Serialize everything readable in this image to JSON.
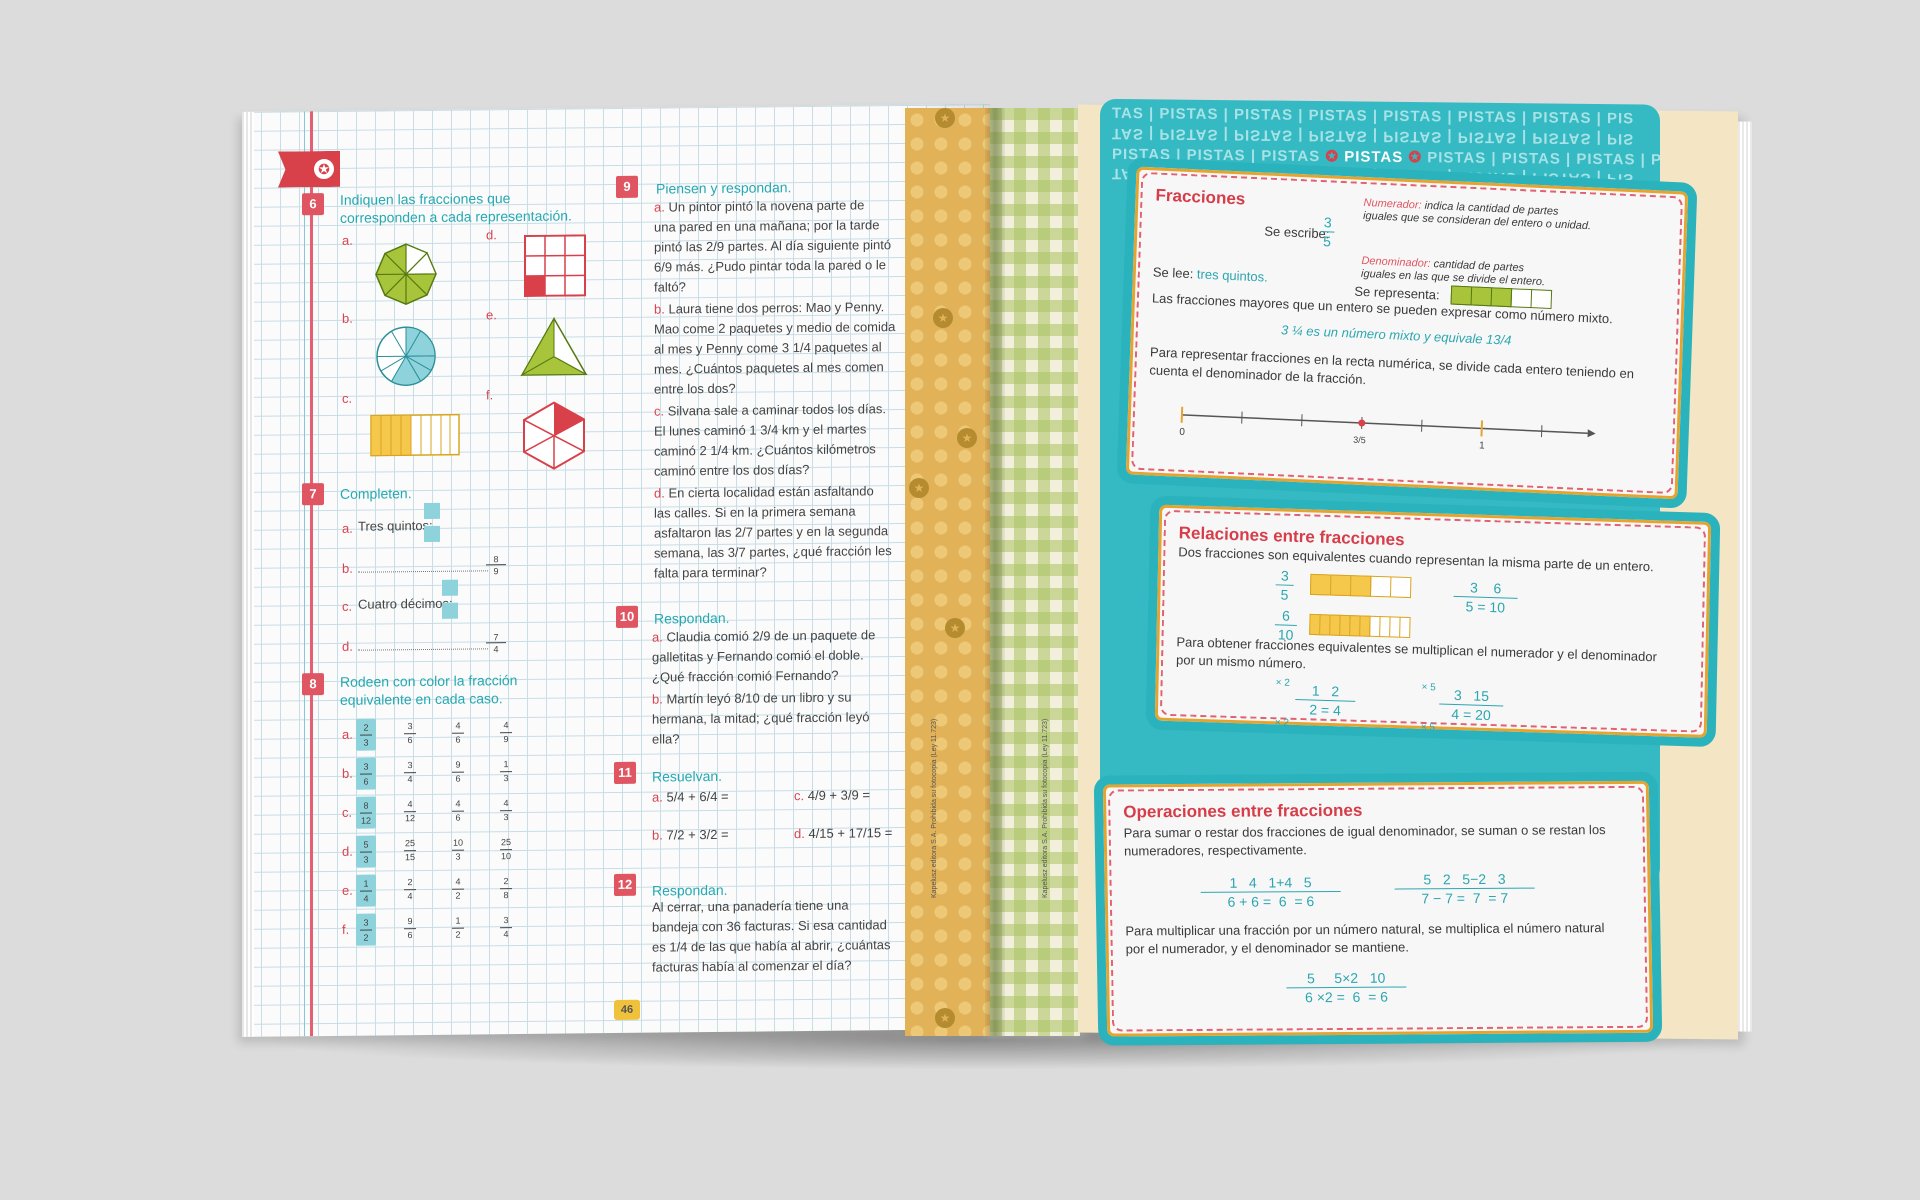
{
  "left_page": {
    "page_number": "46",
    "ex6": {
      "num": "6",
      "title_1": "Indiquen las fracciones que",
      "title_2": "corresponden a cada representación.",
      "labels": [
        "a.",
        "b.",
        "c.",
        "d.",
        "e.",
        "f."
      ]
    },
    "ex7": {
      "num": "7",
      "title": "Completen.",
      "items": [
        {
          "label": "a.",
          "text": "Tres quintos:"
        },
        {
          "label": "b.",
          "text": ": 8/9"
        },
        {
          "label": "c.",
          "text": "Cuatro décimos:"
        },
        {
          "label": "d.",
          "text": ": 7/4"
        }
      ],
      "frac_b": [
        "8",
        "9"
      ],
      "frac_d": [
        "7",
        "4"
      ]
    },
    "ex8": {
      "num": "8",
      "title_1": "Rodeen con color la fracción",
      "title_2": "equivalente en cada caso.",
      "rows": [
        {
          "label": "a.",
          "key": [
            "2",
            "3"
          ],
          "options": [
            [
              "3",
              "6"
            ],
            [
              "4",
              "6"
            ],
            [
              "4",
              "9"
            ]
          ]
        },
        {
          "label": "b.",
          "key": [
            "3",
            "6"
          ],
          "options": [
            [
              "3",
              "4"
            ],
            [
              "9",
              "6"
            ],
            [
              "1",
              "3"
            ]
          ]
        },
        {
          "label": "c.",
          "key": [
            "8",
            "12"
          ],
          "options": [
            [
              "4",
              "12"
            ],
            [
              "4",
              "6"
            ],
            [
              "4",
              "3"
            ]
          ]
        },
        {
          "label": "d.",
          "key": [
            "5",
            "3"
          ],
          "options": [
            [
              "25",
              "15"
            ],
            [
              "10",
              "3"
            ],
            [
              "25",
              "10"
            ]
          ]
        },
        {
          "label": "e.",
          "key": [
            "1",
            "4"
          ],
          "options": [
            [
              "2",
              "4"
            ],
            [
              "4",
              "2"
            ],
            [
              "2",
              "8"
            ]
          ]
        },
        {
          "label": "f.",
          "key": [
            "3",
            "2"
          ],
          "options": [
            [
              "9",
              "6"
            ],
            [
              "1",
              "2"
            ],
            [
              "3",
              "4"
            ]
          ]
        }
      ]
    },
    "ex9": {
      "num": "9",
      "title": "Piensen y respondan.",
      "a": [
        "a.",
        "Un pintor pintó la novena parte de",
        "una pared en una mañana; por la tarde",
        "pintó las 2/9 partes. Al día siguiente pintó",
        "6/9 más. ¿Pudo pintar toda la pared o le",
        "faltó?"
      ],
      "b": [
        "b.",
        "Laura tiene dos perros: Mao y Penny.",
        "Mao come 2 paquetes y medio de comida",
        "al mes y Penny come 3 1/4 paquetes al",
        "mes. ¿Cuántos paquetes al mes comen",
        "entre los dos?"
      ],
      "c": [
        "c.",
        "Silvana sale a caminar todos los días.",
        "El lunes caminó 1 3/4 km y el martes",
        "caminó 2 1/4 km. ¿Cuántos kilómetros",
        "caminó entre los dos días?"
      ],
      "d": [
        "d.",
        "En cierta localidad están asfaltando",
        "las calles. Si en la primera semana",
        "asfaltaron las 2/7 partes y en la segunda",
        "semana, las 3/7 partes, ¿qué fracción les",
        "falta para terminar?"
      ]
    },
    "ex10": {
      "num": "10",
      "title": "Respondan.",
      "a": [
        "a.",
        "Claudia comió 2/9 de un paquete de",
        "galletitas y Fernando comió el doble.",
        "¿Qué fracción comió Fernando?"
      ],
      "b": [
        "b.",
        "Martín leyó 8/10 de un libro y su",
        "hermana, la mitad; ¿qué fracción leyó",
        "ella?"
      ]
    },
    "ex11": {
      "num": "11",
      "title": "Resuelvan.",
      "ops": [
        {
          "label": "a.",
          "expr": "5/4 + 6/4 ="
        },
        {
          "label": "b.",
          "expr": "7/2 + 3/2 ="
        },
        {
          "label": "c.",
          "expr": "4/9 + 3/9 ="
        },
        {
          "label": "d.",
          "expr": "4/15 + 17/15 ="
        }
      ]
    },
    "ex12": {
      "num": "12",
      "title": "Respondan.",
      "lines": [
        "Al cerrar, una panadería tiene una",
        "bandeja con 36 facturas. Si esa cantidad",
        "es 1/4 de las que había al abrir, ¿cuántas",
        "facturas había al comenzar el día?"
      ]
    }
  },
  "spine": {
    "credit_left": "Kapelusz editora S.A. Prohibida su fotocopia (Ley 11.723)",
    "credit_right": "Kapelusz editora S.A. Prohibida su fotocopia (Ley 11.723)"
  },
  "right_page": {
    "pistas_word": "PISTAS",
    "pistas_row": "TAS | PISTAS | PISTAS | PISTAS | PISTAS | PISTAS | PISTAS | PIS",
    "pistas_row_main_left": "PISTAS | PISTAS | PISTAS",
    "pistas_row_main_right": "PISTAS | PISTAS | PISTAS | PIS",
    "card1": {
      "title": "Fracciones",
      "se_escribe": "Se escribe:",
      "numerador_label": "Numerador:",
      "numerador_desc_1": "indica la cantidad de partes",
      "numerador_desc_2": "iguales que se consideran del entero o unidad.",
      "denominador_label": "Denominador:",
      "denominador_desc_1": "cantidad de partes",
      "denominador_desc_2": "iguales en las que se divide el entero.",
      "se_lee": "Se lee:",
      "se_lee_value": "tres quintos.",
      "se_representa": "Se representa:",
      "mixed_text": "Las fracciones mayores que un entero se pueden expresar como número mixto.",
      "mixed_example": "es un número mixto y equivale",
      "recta_1": "Para representar fracciones en la recta numérica, se divide cada entero teniendo en",
      "recta_2": "cuenta el denominador de la fracción.",
      "axis_0": "0",
      "axis_1": "1",
      "axis_mid": "3/5",
      "frac_num": "3",
      "frac_den": "5"
    },
    "card2": {
      "title": "Relaciones entre fracciones",
      "line1": "Dos fracciones son equivalentes cuando representan la misma parte de un entero.",
      "line2": "Para obtener fracciones equivalentes se multiplican el numerador y el denominador",
      "line3": "por un mismo número.",
      "x2": "× 2",
      "x5": "× 5"
    },
    "card3": {
      "title": "Operaciones entre fracciones",
      "line1": "Para sumar o restar dos fracciones de igual denominador, se suman o se restan los",
      "line2": "numeradores, respectivamente.",
      "line3": "Para multiplicar una fracción por un número natural, se multiplica el número natural",
      "line4": "por el numerador, y el denominador se mantiene."
    }
  }
}
